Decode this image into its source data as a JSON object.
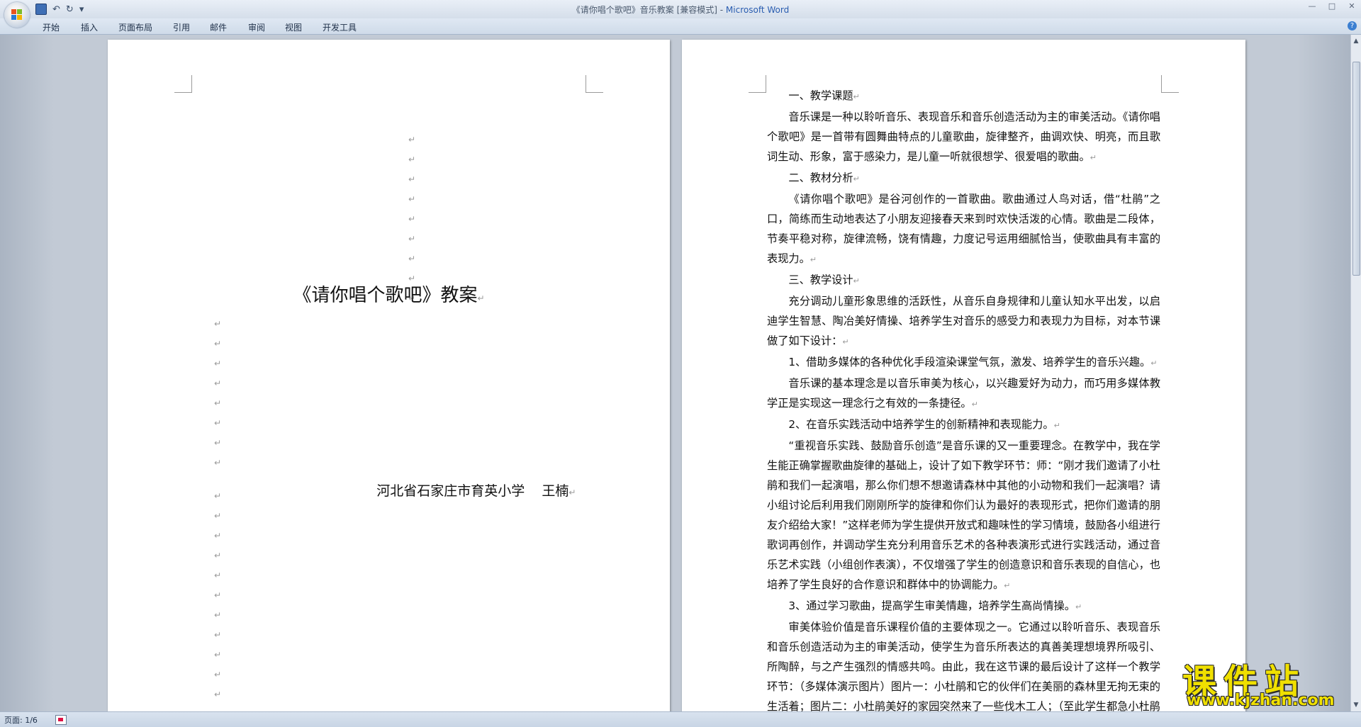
{
  "window": {
    "title_prefix": "《请你唱个歌吧》音乐教案 [兼容模式] - ",
    "title_app": "Microsoft Word",
    "controls": {
      "minimize": "—",
      "maximize": "□",
      "close": "✕"
    },
    "qat_undo": "↶",
    "qat_redo": "↻",
    "qat_more": "▾"
  },
  "ribbon": {
    "tabs": [
      "开始",
      "插入",
      "页面布局",
      "引用",
      "邮件",
      "审阅",
      "视图",
      "开发工具"
    ],
    "help": "?"
  },
  "colors": {
    "accent": "#2a5db0",
    "watermark": "#f0e000"
  },
  "page1": {
    "title": "《请你唱个歌吧》教案",
    "author": "河北省石家庄市育英小学    王楠",
    "para_mark": "↵"
  },
  "page2": {
    "paragraphs": [
      "一、教学课题",
      "音乐课是一种以聆听音乐、表现音乐和音乐创造活动为主的审美活动。《请你唱个歌吧》是一首带有圆舞曲特点的儿童歌曲，旋律整齐，曲调欢快、明亮，而且歌词生动、形象，富于感染力，是儿童一听就很想学、很爱唱的歌曲。",
      "二、教材分析",
      "《请你唱个歌吧》是谷河创作的一首歌曲。歌曲通过人鸟对话，借“杜鹃”之口，简练而生动地表达了小朋友迎接春天来到时欢快活泼的心情。歌曲是二段体，节奏平稳对称，旋律流畅，饶有情趣，力度记号运用细腻恰当，使歌曲具有丰富的表现力。",
      "三、教学设计",
      "充分调动儿童形象思维的活跃性，从音乐自身规律和儿童认知水平出发，以启迪学生智慧、陶冶美好情操、培养学生对音乐的感受力和表现力为目标，对本节课做了如下设计：",
      "1、借助多媒体的各种优化手段渲染课堂气氛，激发、培养学生的音乐兴趣。",
      "音乐课的基本理念是以音乐审美为核心，以兴趣爱好为动力，而巧用多媒体教学正是实现这一理念行之有效的一条捷径。",
      "2、在音乐实践活动中培养学生的创新精神和表现能力。",
      "“重视音乐实践、鼓励音乐创造”是音乐课的又一重要理念。在教学中，我在学生能正确掌握歌曲旋律的基础上，设计了如下教学环节：师：“刚才我们邀请了小杜鹃和我们一起演唱，那么你们想不想邀请森林中其他的小动物和我们一起演唱？请小组讨论后利用我们刚刚所学的旋律和你们认为最好的表现形式，把你们邀请的朋友介绍给大家！”这样老师为学生提供开放式和趣味性的学习情境，鼓励各小组进行歌词再创作，并调动学生充分利用音乐艺术的各种表演形式进行实践活动，通过音乐艺术实践（小组创作表演），不仅增强了学生的创造意识和音乐表现的自信心，也培养了学生良好的合作意识和群体中的协调能力。",
      "3、通过学习歌曲，提高学生审美情趣，培养学生高尚情操。",
      "审美体验价值是音乐课程价值的主要体现之一。它通过以聆听音乐、表现音乐和音乐创造活动为主的审美活动，使学生为音乐所表达的真善美理想境界所吸引、所陶醉，与之产生强烈的情感共鸣。由此，我在这节课的最后设计了这样一个教学环节：（多媒体演示图片）图片一：小杜鹃和它的伙伴们在美丽的森林里无拘无束的生活着；图片二：小杜鹃美好的家园突然来了一些伐木工人；（至此学生都急小杜鹃会怎么样而着急）图片三：美丽的森林变成了荒地，小鸟孤零零"
    ]
  },
  "scrollbar": {
    "up": "▲",
    "down": "▼"
  },
  "status": {
    "page": "页面: 1/6"
  },
  "watermark": {
    "title": "课件站",
    "url": "www.kjzhan.com"
  }
}
